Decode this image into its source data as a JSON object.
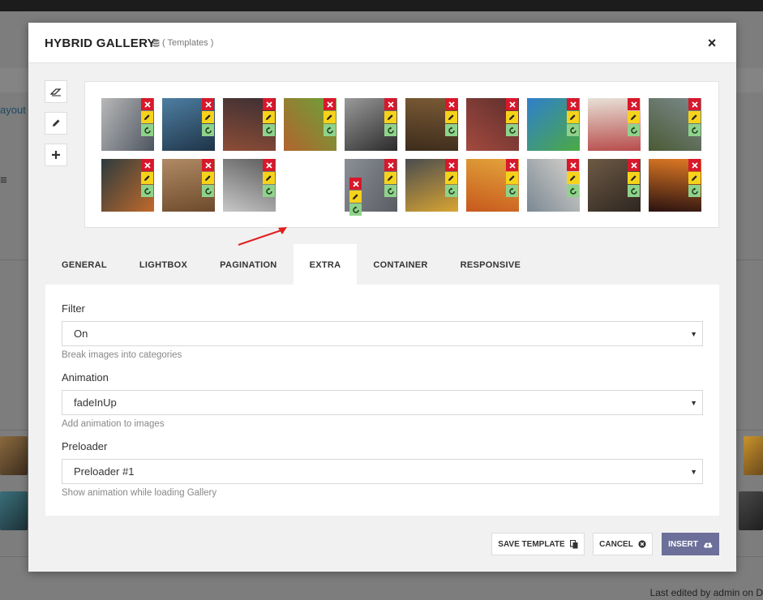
{
  "background": {
    "layout_link": "ayout",
    "status_text": "Last edited by admin on D"
  },
  "modal": {
    "title": "HYBRID GALLERY",
    "templates_link": "( Templates )",
    "close_glyph": "×"
  },
  "tools": [
    {
      "name": "eraser-icon"
    },
    {
      "name": "pencil-icon"
    },
    {
      "name": "plus-icon"
    }
  ],
  "gallery": {
    "images": [
      {
        "id": 1,
        "colors": [
          "#b8b8b8",
          "#4d5560"
        ]
      },
      {
        "id": 2,
        "colors": [
          "#4e7fa3",
          "#1e3346"
        ]
      },
      {
        "id": 3,
        "colors": [
          "#3c2f34",
          "#8d4d36"
        ]
      },
      {
        "id": 4,
        "colors": [
          "#6aa33b",
          "#b2642c"
        ]
      },
      {
        "id": 5,
        "colors": [
          "#9a9a9a",
          "#2a2a2a"
        ]
      },
      {
        "id": 6,
        "colors": [
          "#7a5a35",
          "#3d2c1c"
        ]
      },
      {
        "id": 7,
        "colors": [
          "#5c2e2c",
          "#a44a3f"
        ]
      },
      {
        "id": 8,
        "colors": [
          "#2f7fcc",
          "#4caa43"
        ]
      },
      {
        "id": 9,
        "colors": [
          "#e7e1d6",
          "#b84c4c"
        ]
      },
      {
        "id": 10,
        "colors": [
          "#7d8b8f",
          "#4a5a34"
        ]
      },
      {
        "id": 11,
        "colors": [
          "#2c3b3f",
          "#c26a2a"
        ]
      },
      {
        "id": 12,
        "colors": [
          "#b08a64",
          "#6d4a2c"
        ]
      },
      {
        "id": 13,
        "colors": [
          "#5a5a5a",
          "#c8c8c8"
        ]
      },
      {
        "id": 14,
        "colors": [
          "#8a9096",
          "#5a5c62"
        ]
      },
      {
        "id": 15,
        "colors": [
          "#4a4c50",
          "#d9a531"
        ]
      },
      {
        "id": 16,
        "colors": [
          "#e3a63b",
          "#c7581d"
        ]
      },
      {
        "id": 17,
        "colors": [
          "#d9d5cf",
          "#7a8893"
        ]
      },
      {
        "id": 18,
        "colors": [
          "#6d5a44",
          "#2e2621"
        ]
      },
      {
        "id": 19,
        "colors": [
          "#e07a24",
          "#2a1210"
        ]
      }
    ],
    "dragged_image": {
      "colors": [
        "#6f8fb7",
        "#4a3f34"
      ]
    }
  },
  "tabs": [
    {
      "label": "GENERAL",
      "active": false
    },
    {
      "label": "LIGHTBOX",
      "active": false
    },
    {
      "label": "PAGINATION",
      "active": false
    },
    {
      "label": "EXTRA",
      "active": true
    },
    {
      "label": "CONTAINER",
      "active": false
    },
    {
      "label": "RESPONSIVE",
      "active": false
    }
  ],
  "fields": {
    "filter": {
      "label": "Filter",
      "value": "On",
      "help": "Break images into categories"
    },
    "animation": {
      "label": "Animation",
      "value": "fadeInUp",
      "help": "Add animation to images"
    },
    "preloader": {
      "label": "Preloader",
      "value": "Preloader #1",
      "help": "Show animation while loading Gallery"
    }
  },
  "buttons": {
    "save_template": "SAVE TEMPLATE",
    "cancel": "CANCEL",
    "insert": "INSERT"
  },
  "colors": {
    "delete": "#d8182b",
    "edit": "#f6d21a",
    "refresh": "#8fd28b",
    "primary_button": "#6c6f99",
    "arrow": "#e02020"
  }
}
